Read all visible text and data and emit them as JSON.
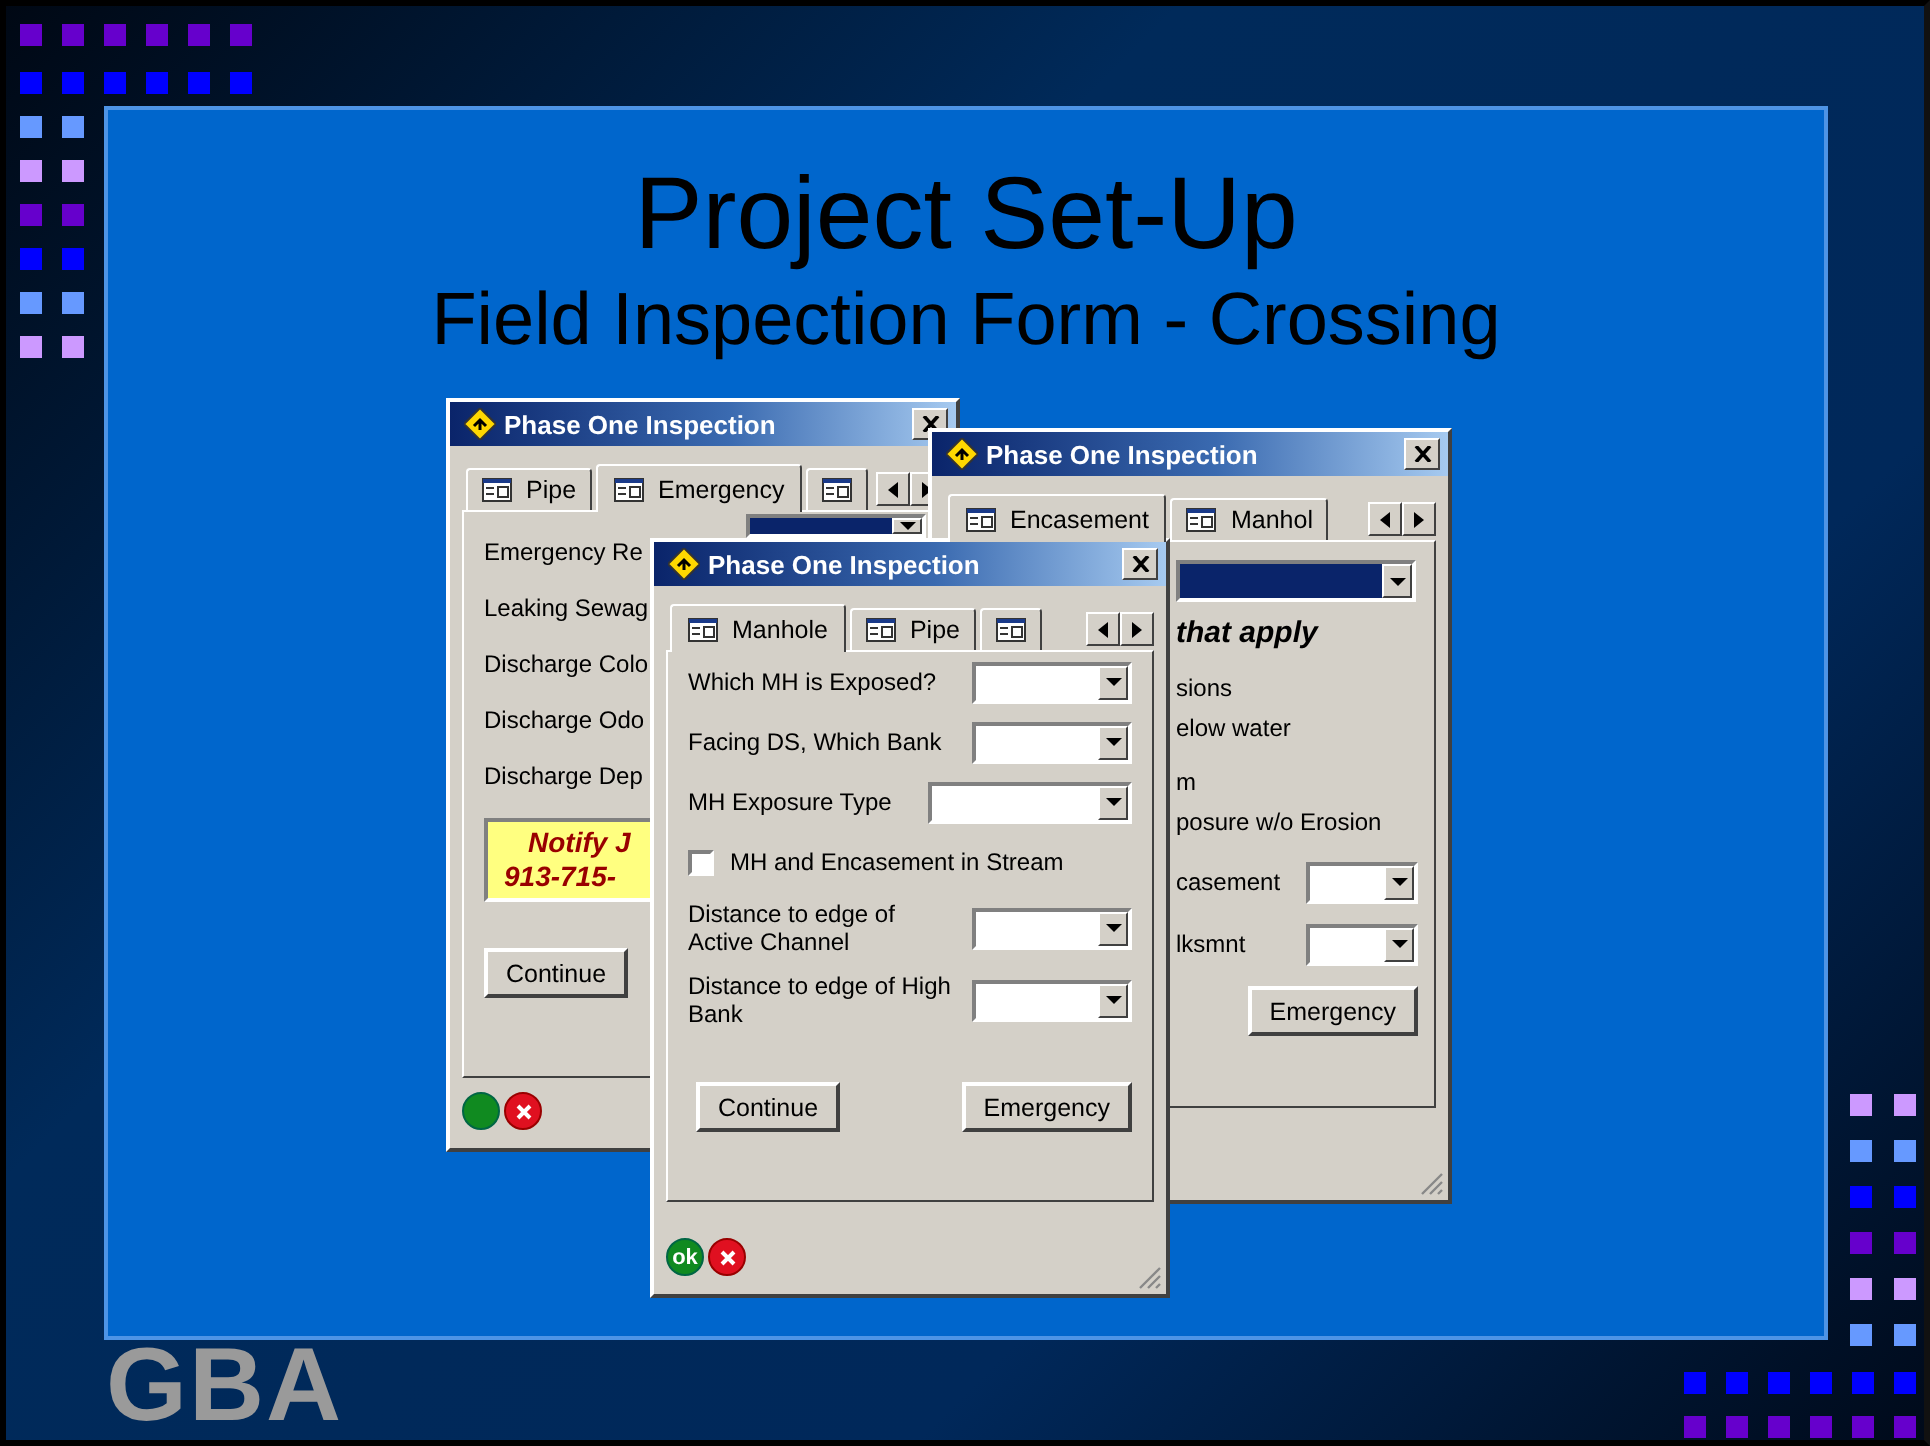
{
  "slide": {
    "title": "Project Set-Up",
    "subtitle": "Field Inspection Form - Crossing",
    "logo": "GBA"
  },
  "back_left_window": {
    "title": "Phase One Inspection",
    "tabs": [
      {
        "label": "Pipe",
        "selected": false
      },
      {
        "label": "Emergency",
        "selected": true
      },
      {
        "selected": false
      }
    ],
    "combo": {
      "highlighted": true
    },
    "fields": [
      {
        "label": "Emergency Re"
      },
      {
        "label": "Leaking Sewag"
      },
      {
        "label": "Discharge Colo"
      },
      {
        "label": "Discharge Odo"
      },
      {
        "label": "Discharge Dep"
      }
    ],
    "notice": [
      "Notify J",
      "913-715-"
    ],
    "buttons": [
      "Continue"
    ]
  },
  "back_right_window": {
    "title": "Phase One Inspection",
    "tabs": [
      {
        "label": "Encasement",
        "selected": true
      },
      {
        "label": "Manhol",
        "selected": false
      }
    ],
    "combo": {
      "highlighted": true
    },
    "heading": "that apply",
    "lines": [
      "sions",
      "elow water",
      "m",
      "posure w/o Erosion"
    ],
    "fields": [
      {
        "label": "casement"
      },
      {
        "label": "lksmnt"
      }
    ],
    "buttons": [
      "Emergency"
    ]
  },
  "front_window": {
    "title": "Phase One Inspection",
    "tabs": [
      {
        "label": "Manhole",
        "selected": true
      },
      {
        "label": "Pipe",
        "selected": false
      },
      {
        "selected": false
      }
    ],
    "rows": [
      {
        "kind": "dropdown",
        "label": "Which MH is Exposed?"
      },
      {
        "kind": "dropdown",
        "label": "Facing DS, Which Bank"
      },
      {
        "kind": "dropdown",
        "label": "MH Exposure Type"
      },
      {
        "kind": "checkbox",
        "label": "MH and Encasement in Stream",
        "checked": false
      },
      {
        "kind": "dropdown",
        "label": "Distance to edge of Active Channel"
      },
      {
        "kind": "dropdown",
        "label": "Distance to edge of High Bank"
      }
    ],
    "buttons": [
      "Continue",
      "Emergency"
    ],
    "ok_label": "ok"
  }
}
